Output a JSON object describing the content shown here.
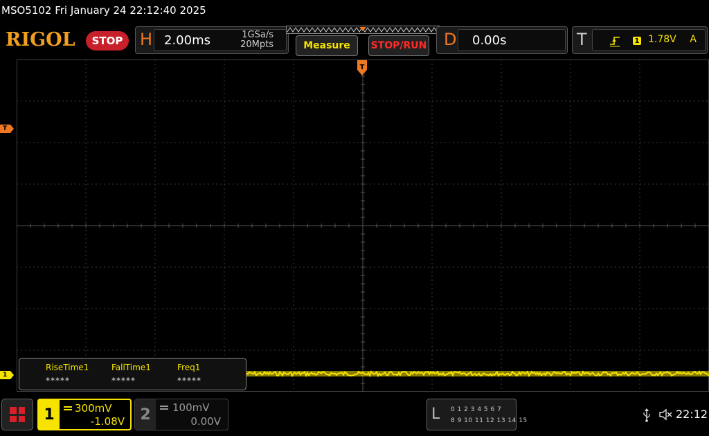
{
  "title_line": "MSO5102  Fri January 24 22:12:40 2025",
  "toolbar": {
    "logo": "RIGOL",
    "run_state": "STOP",
    "horizontal": {
      "letter": "H",
      "timebase": "2.00ms",
      "sample_rate": "1GSa/s",
      "memory_depth": "20Mpts"
    },
    "measure_label": "Measure",
    "stop_run_label": "STOP/RUN",
    "delay": {
      "letter": "D",
      "value": "0.00s"
    },
    "trigger": {
      "letter": "T",
      "source": "1",
      "level": "1.78V",
      "mode": "A"
    }
  },
  "markers": {
    "trigger_level": "T",
    "ch1_ground": "1",
    "trigger_position": "T"
  },
  "measurements": [
    {
      "label": "RiseTime1",
      "value": "*****"
    },
    {
      "label": "FallTime1",
      "value": "*****"
    },
    {
      "label": "Freq1",
      "value": "*****"
    }
  ],
  "channels": {
    "ch1": {
      "number": "1",
      "scale": "300mV",
      "offset": "-1.08V",
      "color": "#f6e300"
    },
    "ch2": {
      "number": "2",
      "scale": "100mV",
      "offset": "0.00V",
      "color": "#999999"
    }
  },
  "logic": {
    "letter": "L",
    "row1": "0 1 2 3   4 5 6 7",
    "row2": "8  9 10 11  12 13 14 15"
  },
  "status": {
    "clock": "22:12"
  },
  "colors": {
    "ch1": "#f6e300",
    "accent": "#f07820",
    "stop": "#c8202a"
  }
}
